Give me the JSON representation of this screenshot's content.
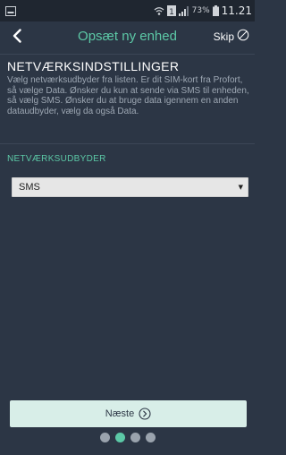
{
  "status_bar": {
    "battery_percent": "73%",
    "sim_label": "1",
    "time": "11.21"
  },
  "header": {
    "title": "Opsæt ny enhed",
    "skip_label": "Skip"
  },
  "section": {
    "title": "NETVÆRKSINDSTILLINGER",
    "description": "Vælg netværksudbyder fra listen. Er dit SIM-kort fra Profort, så vælge Data. Ønsker du kun at sende via SMS til enheden, så vælg SMS. Ønsker du at bruge data igennem en anden dataudbyder, vælg da også Data."
  },
  "field": {
    "label": "NETVÆRKSUDBYDER",
    "selected_value": "SMS"
  },
  "footer": {
    "next_label": "Næste",
    "pager": {
      "total": 4,
      "active_index": 1
    }
  },
  "colors": {
    "background": "#2c3645",
    "accent": "#5cc8a6",
    "button_bg": "#d8eee8"
  },
  "icons": {
    "back": "chevron-left-icon",
    "skip": "circle-slash-icon",
    "next": "circle-chevron-right-icon",
    "select": "caret-down-icon"
  }
}
